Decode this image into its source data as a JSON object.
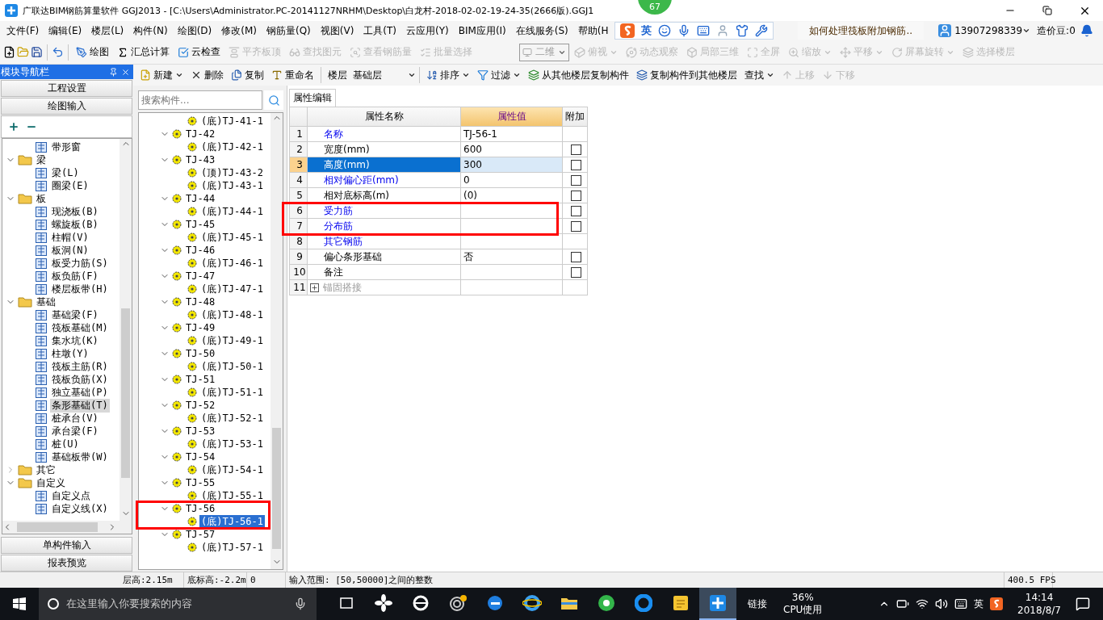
{
  "window": {
    "title": "广联达BIM钢筋算量软件 GGJ2013 - [C:\\Users\\Administrator.PC-20141127NRHM\\Desktop\\白龙村-2018-02-02-19-24-35(2666版).GGJ1",
    "badge": "67"
  },
  "menu": [
    "文件(F)",
    "编辑(E)",
    "楼层(L)",
    "构件(N)",
    "绘图(D)",
    "修改(M)",
    "钢筋量(Q)",
    "视图(V)",
    "工具(T)",
    "云应用(Y)",
    "BIM应用(I)",
    "在线服务(S)",
    "帮助(H"
  ],
  "ime": {
    "label": "英"
  },
  "help_link": "如何处理筏板附加钢筋..",
  "account": "13907298339",
  "beans": "造价豆:0",
  "toolbar": [
    {
      "label": "绘图",
      "disabled": false,
      "kind": "button"
    },
    {
      "label": "汇总计算",
      "disabled": false,
      "kind": "button"
    },
    {
      "label": "云检查",
      "disabled": false,
      "kind": "button"
    },
    {
      "label": "平齐板顶",
      "disabled": true,
      "kind": "button"
    },
    {
      "label": "查找图元",
      "disabled": true,
      "kind": "button"
    },
    {
      "label": "查看钢筋量",
      "disabled": true,
      "kind": "button"
    },
    {
      "label": "批量选择",
      "disabled": true,
      "kind": "button"
    }
  ],
  "view_mode": "二维",
  "view_toolbar": [
    {
      "label": "俯视",
      "disabled": true,
      "kind": "dropdown"
    },
    {
      "label": "动态观察",
      "disabled": true,
      "kind": "button"
    },
    {
      "label": "局部三维",
      "disabled": true,
      "kind": "button"
    },
    {
      "label": "全屏",
      "disabled": true,
      "kind": "button"
    },
    {
      "label": "缩放",
      "disabled": true,
      "kind": "dropdown"
    },
    {
      "label": "平移",
      "disabled": true,
      "kind": "dropdown"
    },
    {
      "label": "屏幕旋转",
      "disabled": true,
      "kind": "dropdown"
    },
    {
      "label": "选择楼层",
      "disabled": true,
      "kind": "button"
    }
  ],
  "component_toolbar": [
    {
      "label": "新建",
      "disabled": false,
      "kind": "dropdown"
    },
    {
      "label": "删除",
      "disabled": false,
      "kind": "button"
    },
    {
      "label": "复制",
      "disabled": false,
      "kind": "button"
    },
    {
      "label": "重命名",
      "disabled": false,
      "kind": "button"
    },
    {
      "label": "楼层",
      "disabled": false,
      "kind": "floor",
      "value": "基础层"
    },
    {
      "label": "排序",
      "disabled": false,
      "kind": "dropdown"
    },
    {
      "label": "过滤",
      "disabled": false,
      "kind": "dropdown"
    },
    {
      "label": "从其他楼层复制构件",
      "disabled": false,
      "kind": "button"
    },
    {
      "label": "复制构件到其他楼层",
      "disabled": false,
      "kind": "button"
    },
    {
      "label": "查找",
      "disabled": false,
      "kind": "menu"
    },
    {
      "label": "上移",
      "disabled": true,
      "kind": "button"
    },
    {
      "label": "下移",
      "disabled": true,
      "kind": "button"
    }
  ],
  "nav": {
    "title": "模块导航栏",
    "top_sections": [
      "工程设置",
      "绘图输入"
    ],
    "bottom_sections": [
      "单构件输入",
      "报表预览"
    ],
    "tree": [
      {
        "label": "带形窗",
        "kind": "leaf",
        "selected": false
      },
      {
        "label": "梁",
        "kind": "folder",
        "expanded": true,
        "selected": false,
        "children": [
          {
            "label": "梁(L)",
            "selected": false
          },
          {
            "label": "圈梁(E)",
            "selected": false
          }
        ]
      },
      {
        "label": "板",
        "kind": "folder",
        "expanded": true,
        "selected": false,
        "children": [
          {
            "label": "现浇板(B)",
            "selected": false
          },
          {
            "label": "螺旋板(B)",
            "selected": false
          },
          {
            "label": "柱帽(V)",
            "selected": false
          },
          {
            "label": "板洞(N)",
            "selected": false
          },
          {
            "label": "板受力筋(S)",
            "selected": false
          },
          {
            "label": "板负筋(F)",
            "selected": false
          },
          {
            "label": "楼层板带(H)",
            "selected": false
          }
        ]
      },
      {
        "label": "基础",
        "kind": "folder",
        "expanded": true,
        "selected": false,
        "children": [
          {
            "label": "基础梁(F)",
            "selected": false
          },
          {
            "label": "筏板基础(M)",
            "selected": false
          },
          {
            "label": "集水坑(K)",
            "selected": false
          },
          {
            "label": "柱墩(Y)",
            "selected": false
          },
          {
            "label": "筏板主筋(R)",
            "selected": false
          },
          {
            "label": "筏板负筋(X)",
            "selected": false
          },
          {
            "label": "独立基础(P)",
            "selected": false
          },
          {
            "label": "条形基础(T)",
            "selected": true
          },
          {
            "label": "桩承台(V)",
            "selected": false
          },
          {
            "label": "承台梁(F)",
            "selected": false
          },
          {
            "label": "桩(U)",
            "selected": false
          },
          {
            "label": "基础板带(W)",
            "selected": false
          }
        ]
      },
      {
        "label": "其它",
        "kind": "folder",
        "expanded": false,
        "selected": false
      },
      {
        "label": "自定义",
        "kind": "folder",
        "expanded": true,
        "selected": false,
        "children": [
          {
            "label": "自定义点",
            "selected": false
          },
          {
            "label": "自定义线(X)",
            "selected": false
          }
        ]
      }
    ]
  },
  "components": {
    "search_placeholder": "搜索构件...",
    "tree": [
      {
        "label": "(底)TJ-41-1",
        "kind": "leaf",
        "selected": false
      },
      {
        "label": "TJ-42",
        "kind": "group",
        "expanded": true,
        "selected": false,
        "children": [
          {
            "label": "(底)TJ-42-1",
            "selected": false
          }
        ]
      },
      {
        "label": "TJ-43",
        "kind": "group",
        "expanded": true,
        "selected": false,
        "children": [
          {
            "label": "(顶)TJ-43-2",
            "selected": false
          },
          {
            "label": "(底)TJ-43-1",
            "selected": false
          }
        ]
      },
      {
        "label": "TJ-44",
        "kind": "group",
        "expanded": true,
        "selected": false,
        "children": [
          {
            "label": "(底)TJ-44-1",
            "selected": false
          }
        ]
      },
      {
        "label": "TJ-45",
        "kind": "group",
        "expanded": true,
        "selected": false,
        "children": [
          {
            "label": "(底)TJ-45-1",
            "selected": false
          }
        ]
      },
      {
        "label": "TJ-46",
        "kind": "group",
        "expanded": true,
        "selected": false,
        "children": [
          {
            "label": "(底)TJ-46-1",
            "selected": false
          }
        ]
      },
      {
        "label": "TJ-47",
        "kind": "group",
        "expanded": true,
        "selected": false,
        "children": [
          {
            "label": "(底)TJ-47-1",
            "selected": false
          }
        ]
      },
      {
        "label": "TJ-48",
        "kind": "group",
        "expanded": true,
        "selected": false,
        "children": [
          {
            "label": "(底)TJ-48-1",
            "selected": false
          }
        ]
      },
      {
        "label": "TJ-49",
        "kind": "group",
        "expanded": true,
        "selected": false,
        "children": [
          {
            "label": "(底)TJ-49-1",
            "selected": false
          }
        ]
      },
      {
        "label": "TJ-50",
        "kind": "group",
        "expanded": true,
        "selected": false,
        "children": [
          {
            "label": "(底)TJ-50-1",
            "selected": false
          }
        ]
      },
      {
        "label": "TJ-51",
        "kind": "group",
        "expanded": true,
        "selected": false,
        "children": [
          {
            "label": "(底)TJ-51-1",
            "selected": false
          }
        ]
      },
      {
        "label": "TJ-52",
        "kind": "group",
        "expanded": true,
        "selected": false,
        "children": [
          {
            "label": "(底)TJ-52-1",
            "selected": false
          }
        ]
      },
      {
        "label": "TJ-53",
        "kind": "group",
        "expanded": true,
        "selected": false,
        "children": [
          {
            "label": "(底)TJ-53-1",
            "selected": false
          }
        ]
      },
      {
        "label": "TJ-54",
        "kind": "group",
        "expanded": true,
        "selected": false,
        "children": [
          {
            "label": "(底)TJ-54-1",
            "selected": false
          }
        ]
      },
      {
        "label": "TJ-55",
        "kind": "group",
        "expanded": true,
        "selected": false,
        "children": [
          {
            "label": "(底)TJ-55-1",
            "selected": false
          }
        ]
      },
      {
        "label": "TJ-56",
        "kind": "group",
        "expanded": true,
        "selected": false,
        "highlighted": true,
        "children": [
          {
            "label": "(底)TJ-56-1",
            "selected": true
          }
        ]
      },
      {
        "label": "TJ-57",
        "kind": "group",
        "expanded": true,
        "selected": false,
        "children": [
          {
            "label": "(底)TJ-57-1",
            "selected": false
          }
        ]
      }
    ]
  },
  "properties": {
    "tab": "属性编辑",
    "columns": [
      "属性名称",
      "属性值",
      "附加"
    ],
    "rows": [
      {
        "number": "1",
        "name": "名称",
        "value": "TJ-56-1",
        "kind": "public",
        "attach": false,
        "selected": false
      },
      {
        "number": "2",
        "name": "宽度(mm)",
        "value": "600",
        "kind": "private",
        "attach": true,
        "checked": false,
        "selected": false
      },
      {
        "number": "3",
        "name": "高度(mm)",
        "value": "300",
        "kind": "private",
        "attach": true,
        "checked": false,
        "selected": true
      },
      {
        "number": "4",
        "name": "相对偏心距(mm)",
        "value": "0",
        "kind": "public",
        "attach": true,
        "checked": false,
        "selected": false
      },
      {
        "number": "5",
        "name": "相对底标高(m)",
        "value": "(0)",
        "kind": "private",
        "attach": true,
        "checked": false,
        "selected": false
      },
      {
        "number": "6",
        "name": "受力筋",
        "value": "",
        "kind": "public",
        "attach": true,
        "checked": false,
        "selected": false,
        "highlighted": true
      },
      {
        "number": "7",
        "name": "分布筋",
        "value": "",
        "kind": "public",
        "attach": true,
        "checked": false,
        "selected": false,
        "highlighted": true
      },
      {
        "number": "8",
        "name": "其它钢筋",
        "value": "",
        "kind": "public",
        "attach": false,
        "selected": false
      },
      {
        "number": "9",
        "name": "偏心条形基础",
        "value": "否",
        "kind": "private",
        "attach": true,
        "checked": false,
        "selected": false
      },
      {
        "number": "10",
        "name": "备注",
        "value": "",
        "kind": "private",
        "attach": true,
        "checked": false,
        "selected": false
      },
      {
        "number": "11",
        "name": "锚固搭接",
        "value": "",
        "kind": "group",
        "attach": false,
        "selected": false
      }
    ]
  },
  "status_bar": [
    "层高:2.15m",
    "底标高:-2.2m",
    "0",
    "输入范围: [50,50000]之间的整数",
    "400.5 FPS"
  ],
  "taskbar": {
    "search_placeholder": "在这里输入你要搜索的内容",
    "apps": [
      {
        "kind": "taskview",
        "selected": false
      },
      {
        "kind": "fan",
        "selected": false
      },
      {
        "kind": "ie-old",
        "selected": false
      },
      {
        "kind": "swirl",
        "selected": false
      },
      {
        "kind": "edge",
        "selected": false
      },
      {
        "kind": "ie",
        "selected": false
      },
      {
        "kind": "folder",
        "selected": false
      },
      {
        "kind": "green",
        "selected": false
      },
      {
        "kind": "g",
        "selected": false
      },
      {
        "kind": "notes",
        "selected": false
      },
      {
        "kind": "glodon",
        "selected": true
      }
    ],
    "link_label": "链接",
    "cpu_value": "36%",
    "cpu_label": "CPU使用",
    "ime": "英",
    "time": "14:14",
    "date": "2018/8/7"
  }
}
